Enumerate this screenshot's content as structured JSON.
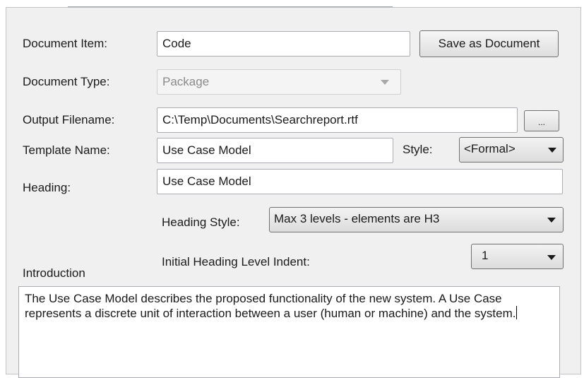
{
  "form": {
    "document_item": {
      "label": "Document Item:",
      "value": "Code"
    },
    "save_button": "Save as Document",
    "document_type": {
      "label": "Document Type:",
      "value": "Package"
    },
    "output_filename": {
      "label": "Output Filename:",
      "value": "C:\\Temp\\Documents\\Searchreport.rtf",
      "browse_label": "..."
    },
    "template_name": {
      "label": "Template Name:",
      "value": "Use Case Model"
    },
    "style": {
      "label": "Style:",
      "value": "<Formal>"
    },
    "heading": {
      "label": "Heading:",
      "value": "Use Case Model"
    },
    "heading_style": {
      "label": "Heading Style:",
      "value": "Max 3 levels - elements are H3"
    },
    "initial_indent": {
      "label": "Initial Heading Level Indent:",
      "value": "1"
    },
    "introduction": {
      "label": "Introduction",
      "text": "The Use Case Model describes the proposed functionality of the new system. A Use Case represents a discrete unit of interaction between a user (human or machine) and the system."
    }
  }
}
